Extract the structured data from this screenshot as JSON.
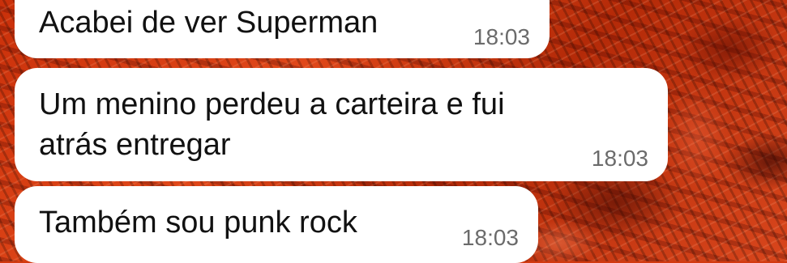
{
  "chat": {
    "messages": [
      {
        "text": "Acabei de ver Superman",
        "time": "18:03"
      },
      {
        "text_line1": "Um menino perdeu a carteira e fui",
        "text_line2": "atrás entregar",
        "time": "18:03"
      },
      {
        "text": "Também sou punk rock",
        "time": "18:03"
      }
    ]
  },
  "colors": {
    "wallpaper": "#d23a10",
    "bubble": "#ffffff",
    "text": "#111111",
    "timestamp": "#6b6b6b"
  }
}
